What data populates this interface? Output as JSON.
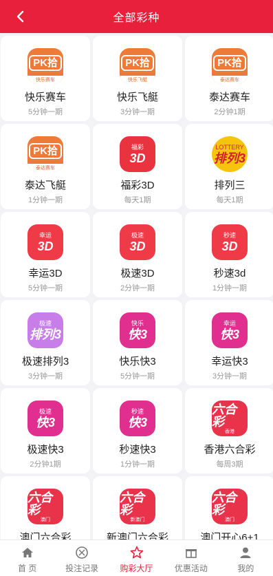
{
  "header": {
    "title": "全部彩种",
    "back_icon": "chevron-left-icon"
  },
  "games": [
    {
      "name": "快乐赛车",
      "period": "5分钟一期",
      "icon": {
        "style": "pk",
        "label": "PK拾",
        "band": "快乐赛车",
        "color": "#ee7a3a"
      }
    },
    {
      "name": "快乐飞艇",
      "period": "3分钟一期",
      "icon": {
        "style": "pk",
        "label": "PK拾",
        "band": "快乐飞艇",
        "color": "#ee7a3a"
      }
    },
    {
      "name": "泰达赛车",
      "period": "2分钟1期",
      "icon": {
        "style": "pk",
        "label": "PK拾",
        "band": "泰达赛车",
        "color": "#ee7a3a"
      }
    },
    {
      "name": "泰达飞艇",
      "period": "1分钟一期",
      "icon": {
        "style": "pk",
        "label": "PK拾",
        "band": "泰达赛车",
        "color": "#ee7a3a"
      }
    },
    {
      "name": "福彩3D",
      "period": "每天1期",
      "icon": {
        "style": "rounded",
        "top": "福彩",
        "main": "3D",
        "sub": "",
        "color": "#e9343f"
      }
    },
    {
      "name": "排列三",
      "period": "每天1期",
      "icon": {
        "style": "circle",
        "top": "LOTTERY",
        "main": "排列3",
        "sub": "",
        "color": "#f6c40c"
      }
    },
    {
      "name": "幸运3D",
      "period": "5分钟一期",
      "icon": {
        "style": "rounded",
        "top": "幸运",
        "main": "3D",
        "sub": "",
        "color": "#ef3b48"
      }
    },
    {
      "name": "极速3D",
      "period": "2分钟一期",
      "icon": {
        "style": "rounded",
        "top": "极速",
        "main": "3D",
        "sub": "",
        "color": "#ef3b48"
      }
    },
    {
      "name": "秒速3d",
      "period": "1分钟一期",
      "icon": {
        "style": "rounded",
        "top": "秒速",
        "main": "3D",
        "sub": "",
        "color": "#ef3b48"
      }
    },
    {
      "name": "极速排列3",
      "period": "3分钟一期",
      "icon": {
        "style": "rounded",
        "top": "极速",
        "main": "排列3",
        "sub": "",
        "color": "#c77ee8"
      }
    },
    {
      "name": "快乐快3",
      "period": "5分钟一期",
      "icon": {
        "style": "rounded",
        "top": "快乐",
        "main": "快3",
        "sub": "",
        "color": "#e02f8f"
      }
    },
    {
      "name": "幸运快3",
      "period": "3分钟一期",
      "icon": {
        "style": "rounded",
        "top": "幸运",
        "main": "快3",
        "sub": "",
        "color": "#e02f8f"
      }
    },
    {
      "name": "极速快3",
      "period": "2分钟1期",
      "icon": {
        "style": "rounded",
        "top": "极速",
        "main": "快3",
        "sub": "",
        "color": "#e02f8f"
      }
    },
    {
      "name": "秒速快3",
      "period": "1分钟一期",
      "icon": {
        "style": "rounded",
        "top": "秒速",
        "main": "快3",
        "sub": "",
        "color": "#e02f8f"
      }
    },
    {
      "name": "香港六合彩",
      "period": "每周3期",
      "icon": {
        "style": "rounded",
        "top": "",
        "main": "六合彩",
        "sub": "香港",
        "color": "#e8334a"
      }
    },
    {
      "name": "澳门六合彩",
      "period": "",
      "icon": {
        "style": "rounded",
        "top": "",
        "main": "六合彩",
        "sub": "澳门",
        "color": "#e8334a"
      }
    },
    {
      "name": "新澳门六合彩",
      "period": "",
      "icon": {
        "style": "rounded",
        "top": "",
        "main": "六合彩",
        "sub": "新澳门",
        "color": "#e8334a"
      }
    },
    {
      "name": "澳门开心6+1",
      "period": "",
      "icon": {
        "style": "rounded",
        "top": "",
        "main": "六合彩",
        "sub": "澳门",
        "color": "#e8334a"
      }
    }
  ],
  "tabbar": {
    "active_color": "#e8203b",
    "tabs": [
      {
        "label": "首 页",
        "icon": "home-icon",
        "active": false
      },
      {
        "label": "投注记录",
        "icon": "bet-record-icon",
        "active": false
      },
      {
        "label": "购彩大厅",
        "icon": "star-icon",
        "active": true
      },
      {
        "label": "优惠活动",
        "icon": "gift-icon",
        "active": false
      },
      {
        "label": "我的",
        "icon": "user-icon",
        "active": false
      }
    ]
  }
}
